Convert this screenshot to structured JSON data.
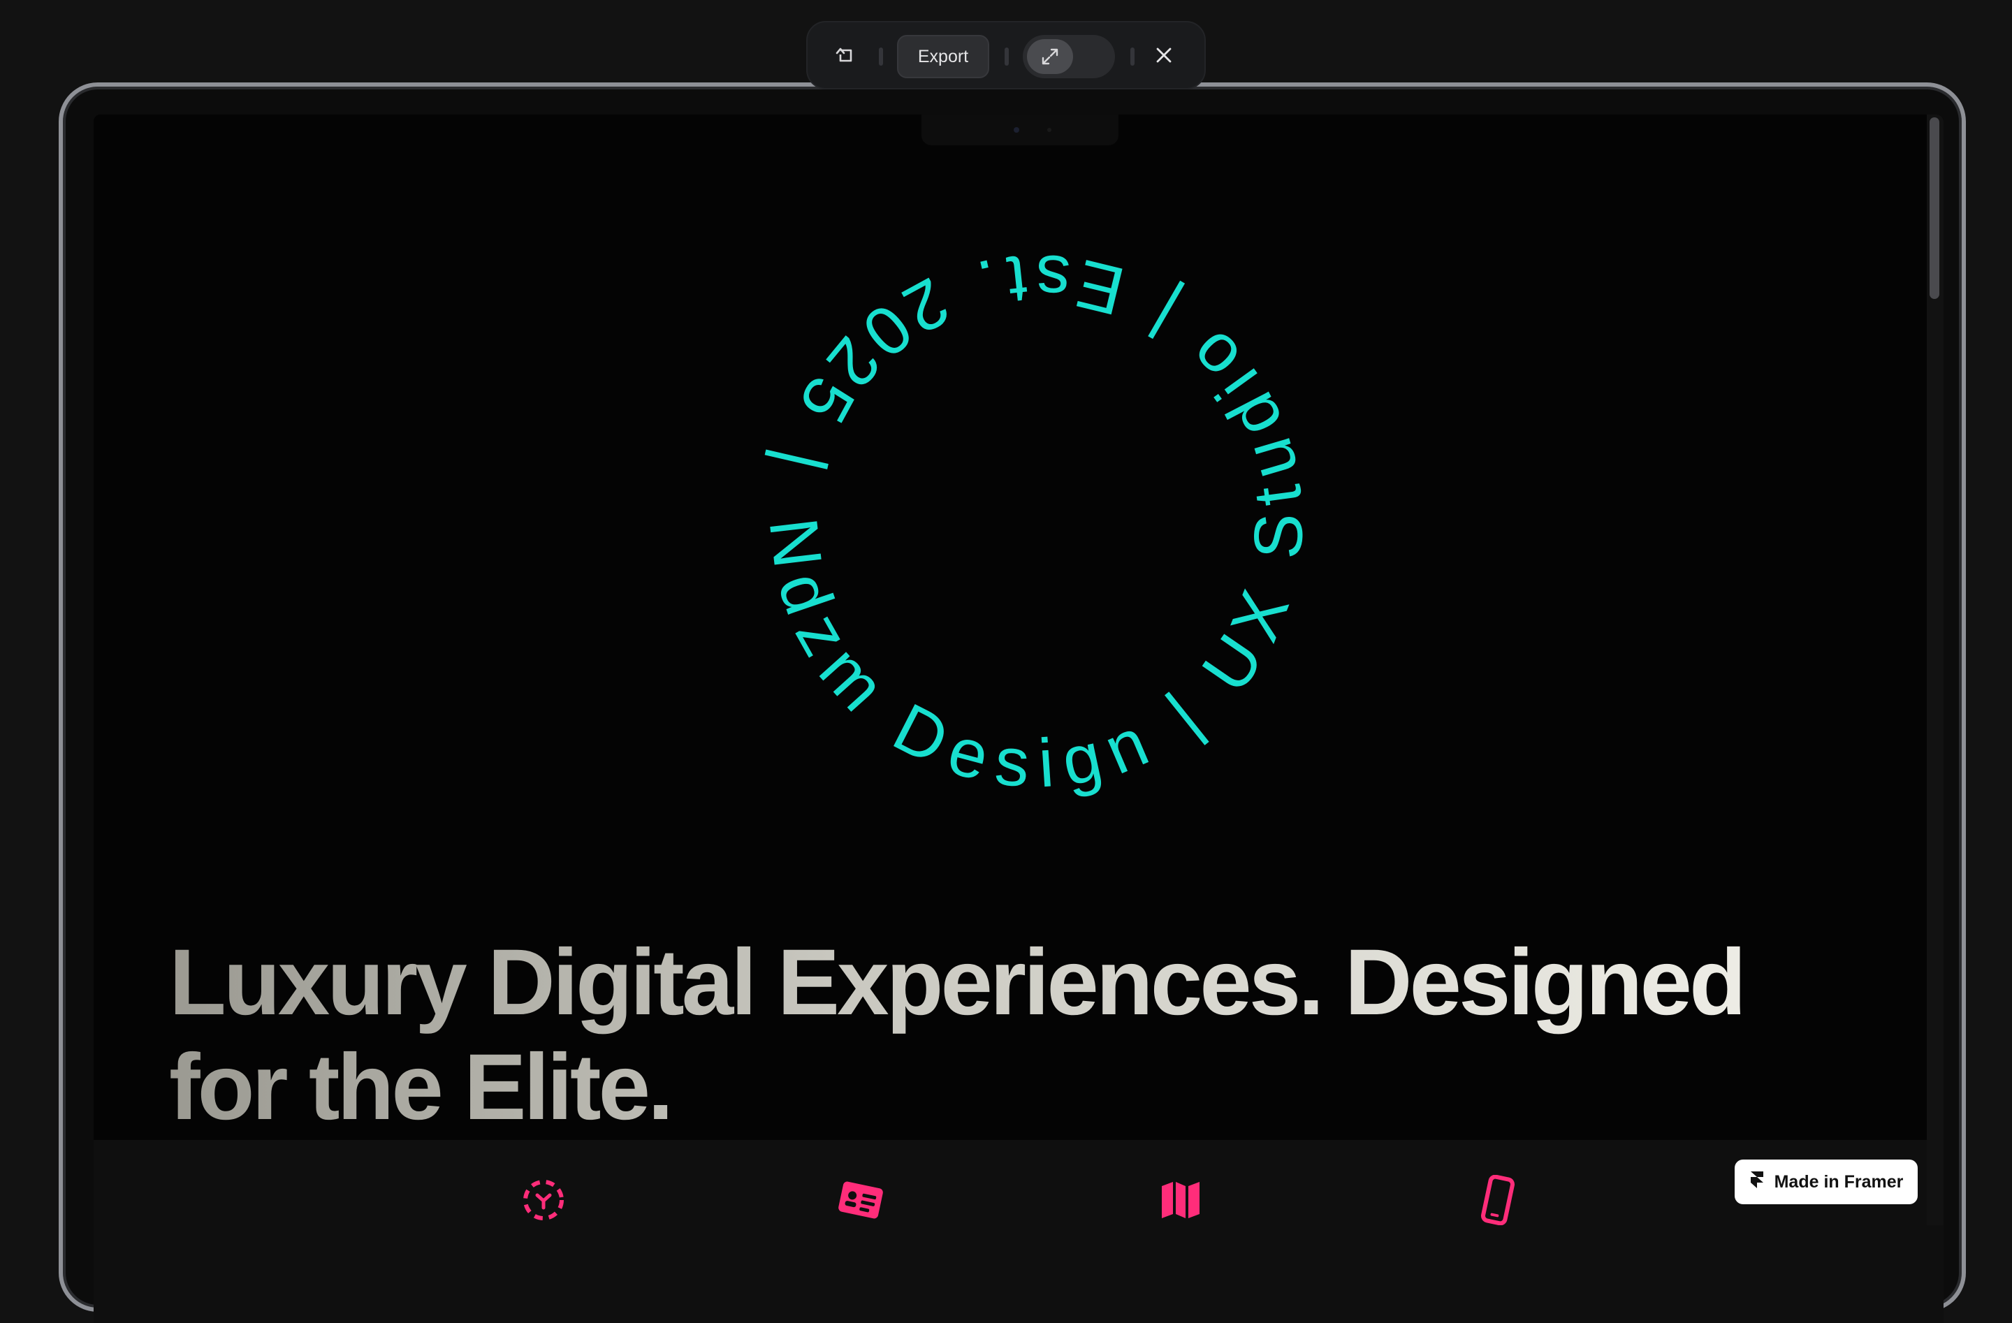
{
  "toolbar": {
    "undo_icon": "undo-icon",
    "export_label": "Export",
    "expand_icon": "expand-icon",
    "close_icon": "close-icon"
  },
  "hero": {
    "circular_badge_text": "Ndzm Design | UX Studio | Est. 2025 |",
    "title": "Luxury Digital Experiences. Designed for the Elite."
  },
  "features": {
    "icons": [
      "dashed-circle-icon",
      "id-card-icon",
      "map-icon",
      "phone-icon"
    ]
  },
  "framer_badge": {
    "label": "Made in Framer",
    "icon": "framer-logo-icon"
  },
  "colors": {
    "accent_teal": "#18dfcf",
    "accent_pink": "#ff2d7a",
    "background": "#121212"
  }
}
